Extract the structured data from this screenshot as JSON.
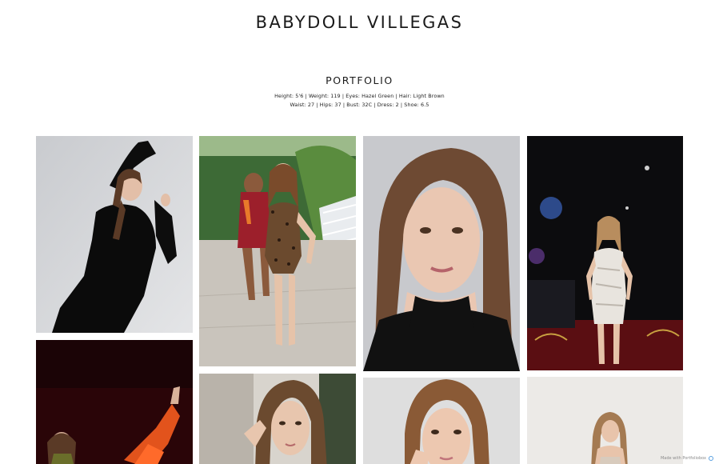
{
  "header": {
    "title": "BABYDOLL VILLEGAS"
  },
  "portfolio": {
    "heading": "PORTFOLIO",
    "stats_line_1": "Height: 5'6 | Weight: 119 | Eyes: Hazel Green | Hair: Light Brown",
    "stats_line_2": "Waist: 27 | Hips: 37 | Bust: 32C | Dress: 2 | Shoe: 6.5"
  },
  "gallery": {
    "photos": [
      {
        "subject": "model in black long-sleeve dress, studio pose"
      },
      {
        "subject": "model in leopard swimsuit on runway"
      },
      {
        "subject": "close-up portrait in black turtleneck"
      },
      {
        "subject": "model in white satin mini dress at event"
      },
      {
        "subject": "model in orange outfit on dark red backdrop"
      },
      {
        "subject": "portrait by doorway"
      },
      {
        "subject": "close-up portrait with hand on chin"
      },
      {
        "subject": "model seated in light studio"
      }
    ]
  },
  "footer": {
    "badge_text": "Made with Portfoliobox"
  },
  "colors": {
    "background": "#ffffff",
    "text": "#1a1a1a",
    "badge_icon": "#5aa0e0"
  }
}
